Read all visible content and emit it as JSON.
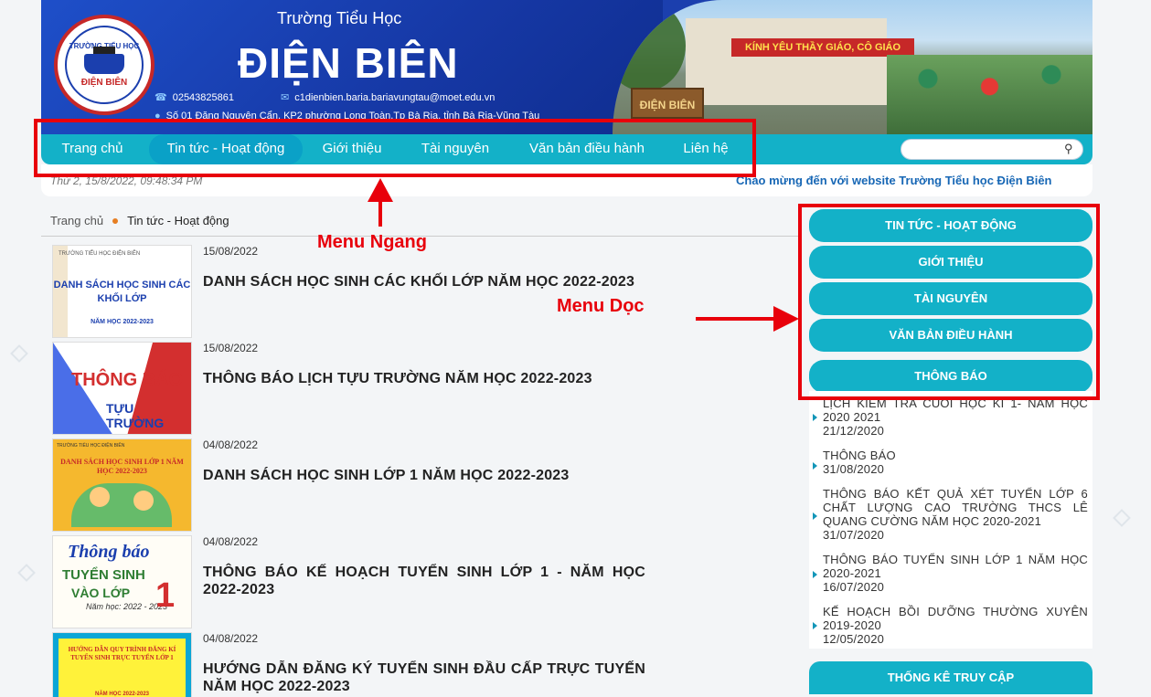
{
  "header": {
    "subtitle": "Trường Tiểu Học",
    "title": "ĐIỆN BIÊN",
    "phone": "02543825861",
    "email": "c1dienbien.baria.bariavungtau@moet.edu.vn",
    "address": "Số 01 Đặng Nguyên Cẩn, KP2 phường Long Toàn,Tp Bà Rịa, tỉnh Bà Rịa-Vũng Tàu",
    "logo_top": "TRƯỜNG TIỂU HỌC",
    "logo_bottom": "ĐIỆN BIÊN",
    "photo_banner": "KÍNH YÊU THẦY GIÁO, CÔ GIÁO",
    "photo_sign": "ĐIỆN BIÊN"
  },
  "nav": {
    "items": [
      {
        "label": "Trang chủ"
      },
      {
        "label": "Tin tức - Hoạt động"
      },
      {
        "label": "Giới thiệu"
      },
      {
        "label": "Tài nguyên"
      },
      {
        "label": "Văn bản điều hành"
      },
      {
        "label": "Liên hệ"
      }
    ],
    "search_placeholder": ""
  },
  "infobar": {
    "datetime": "Thứ 2, 15/8/2022, 09:48:34 PM",
    "welcome": "Chào mừng đến với website Trường Tiểu học Điện Biên"
  },
  "breadcrumb": {
    "home": "Trang chủ",
    "current": "Tin tức - Hoạt động"
  },
  "news": [
    {
      "date": "15/08/2022",
      "title": "DANH SÁCH HỌC SINH CÁC KHỐI LỚP NĂM HỌC 2022-2023",
      "thumb": {
        "small": "TRƯỜNG TIỂU HỌC ĐIỆN BIÊN",
        "main": "DANH SÁCH HỌC SINH CÁC KHỐI LỚP",
        "year": "NĂM HỌC 2022-2023"
      }
    },
    {
      "date": "15/08/2022",
      "title": "THÔNG BÁO LỊCH TỰU TRƯỜNG NĂM HỌC 2022-2023",
      "thumb": {
        "t1": "THÔNG BÁO",
        "t2": "TỰU TRƯỜNG"
      }
    },
    {
      "date": "04/08/2022",
      "title": "DANH SÁCH HỌC SINH LỚP 1 NĂM HỌC 2022-2023",
      "thumb": {
        "small": "TRƯỜNG TIỂU HỌC ĐIỆN BIÊN",
        "main": "DANH SÁCH HỌC SINH LỚP 1 NĂM HỌC 2022-2023"
      }
    },
    {
      "date": "04/08/2022",
      "title": "THÔNG BÁO KẾ HOẠCH TUYỂN SINH LỚP 1 - NĂM HỌC 2022-2023",
      "thumb": {
        "t1": "Thông báo",
        "t2": "TUYỂN SINH",
        "t3": "VÀO LỚP",
        "t4": "Năm học: 2022 - 2023",
        "num": "1"
      }
    },
    {
      "date": "04/08/2022",
      "title": "HƯỚNG DẪN ĐĂNG KÝ TUYỂN SINH ĐẦU CẤP TRỰC TUYẾN NĂM HỌC 2022-2023",
      "thumb": {
        "main": "HƯỚNG DẪN QUY TRÌNH ĐĂNG KÍ TUYỂN SINH TRỰC TUYẾN LỚP 1",
        "year": "NĂM HỌC 2022-2023"
      }
    }
  ],
  "sidebar": {
    "menu": [
      {
        "label": "TIN TỨC - HOẠT ĐỘNG"
      },
      {
        "label": "GIỚI THIỆU"
      },
      {
        "label": "TÀI NGUYÊN"
      },
      {
        "label": "VĂN BẢN ĐIỀU HÀNH"
      },
      {
        "label": "THÔNG BÁO"
      }
    ],
    "notices": [
      {
        "title": "LỊCH KIỂM TRA CUỐI HỌC KÌ 1- NĂM HỌC 2020 2021",
        "date": "21/12/2020"
      },
      {
        "title": "THÔNG BÁO",
        "date": "31/08/2020"
      },
      {
        "title": "THÔNG BÁO KẾT QUẢ XÉT TUYỂN LỚP 6 CHẤT LƯỢNG CAO TRƯỜNG THCS LÊ QUANG CƯỜNG NĂM HỌC 2020-2021",
        "date": "31/07/2020"
      },
      {
        "title": "THÔNG BÁO TUYỂN SINH LỚP 1 NĂM HỌC 2020-2021",
        "date": "16/07/2020"
      },
      {
        "title": "KẾ HOẠCH BỒI DƯỠNG THƯỜNG XUYÊN 2019-2020",
        "date": "12/05/2020"
      }
    ],
    "stats_title": "THỐNG KÊ TRUY CẬP"
  },
  "annotations": {
    "menu_ngang": "Menu Ngang",
    "menu_doc": "Menu Dọc",
    "color": "#e8000b"
  },
  "colors": {
    "header_blue": "#1b3fae",
    "nav_teal": "#13b1c8",
    "welcome_blue": "#1767b5"
  }
}
